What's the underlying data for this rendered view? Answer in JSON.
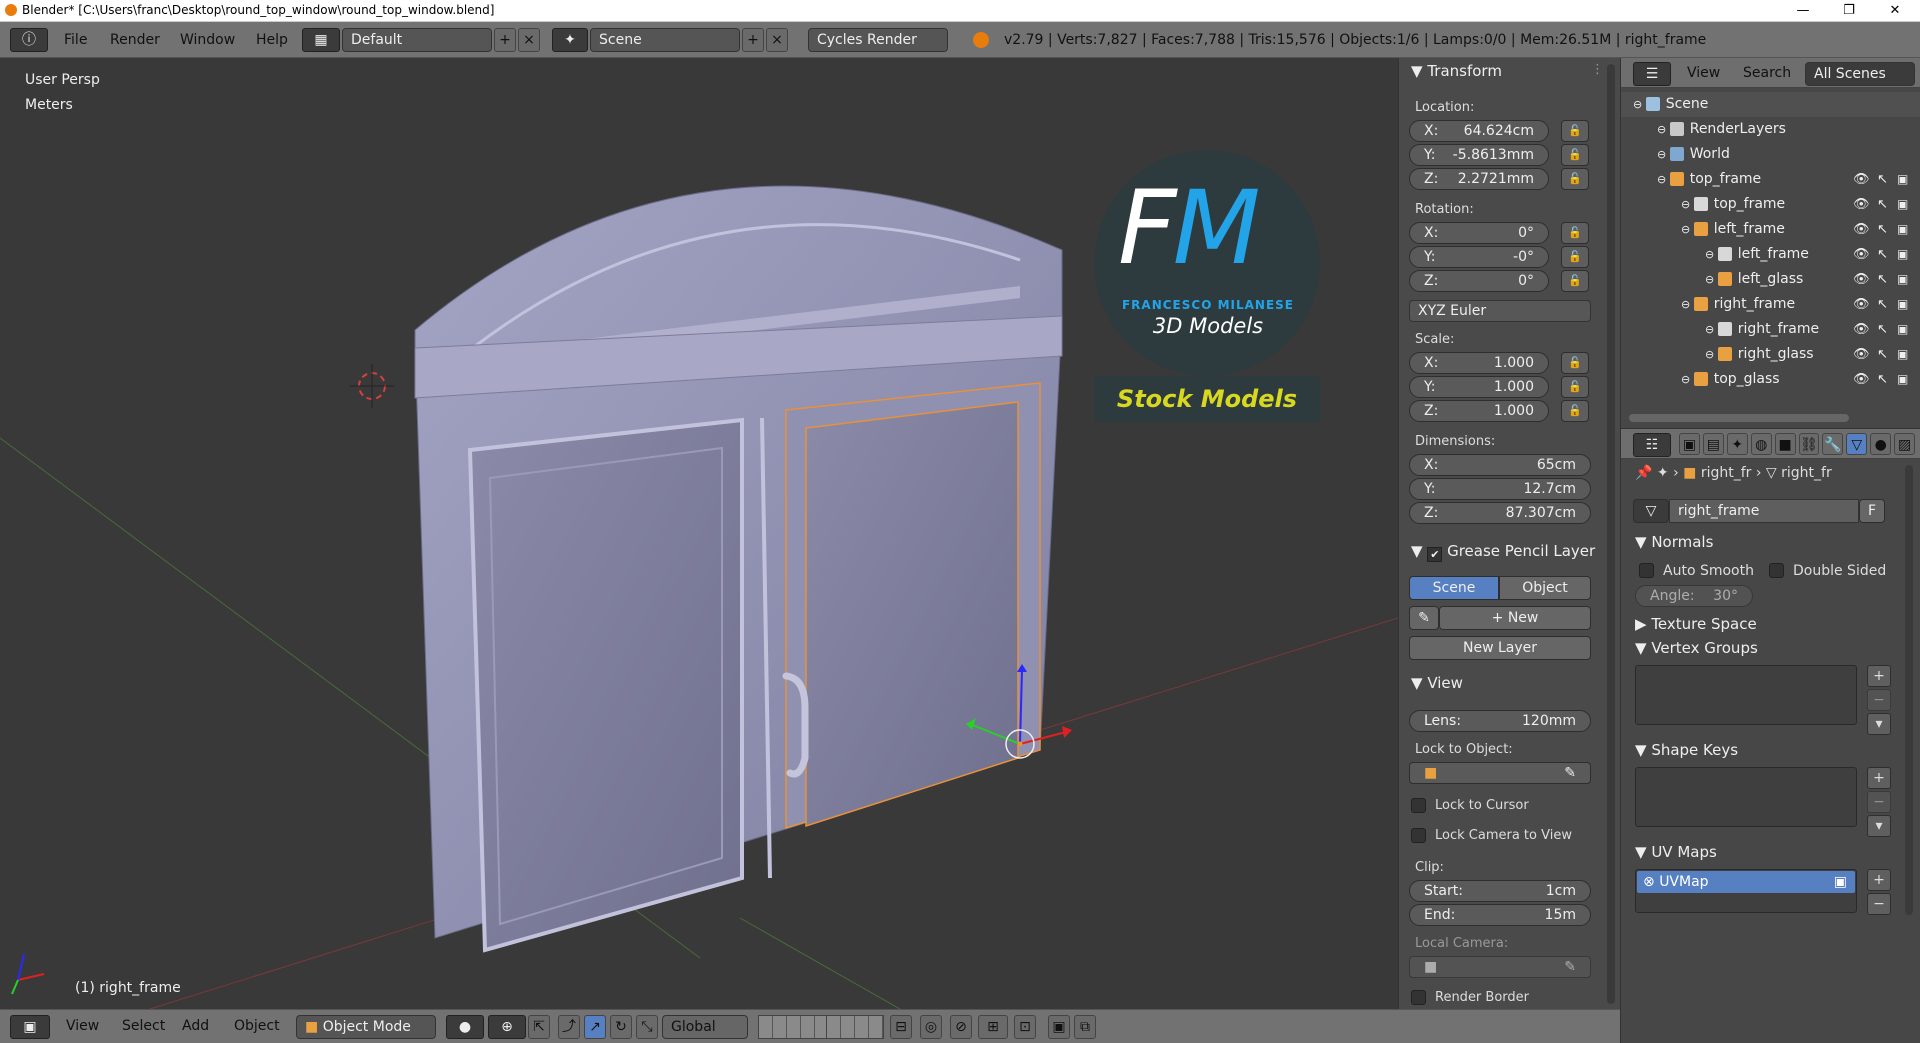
{
  "titlebar": {
    "title": "Blender* [C:\\Users\\franc\\Desktop\\round_top_window\\round_top_window.blend]",
    "minimize": "—",
    "maximize": "❐",
    "close": "✕"
  },
  "topbar": {
    "menus": [
      "File",
      "Render",
      "Window",
      "Help"
    ],
    "layout": "Default",
    "scene": "Scene",
    "engine": "Cycles Render",
    "stats": "v2.79 | Verts:7,827 | Faces:7,788 | Tris:15,576 | Objects:1/6 | Lamps:0/0 | Mem:26.51M | right_frame"
  },
  "viewport": {
    "view_name": "User Persp",
    "units": "Meters",
    "active_object": "(1) right_frame"
  },
  "watermark": {
    "initials": "FM",
    "name": "FRANCESCO MILANESE",
    "tagline": "3D Models",
    "banner": "Stock Models"
  },
  "bottombar": {
    "menus": [
      "View",
      "Select",
      "Add",
      "Object"
    ],
    "mode": "Object Mode",
    "orientation": "Global"
  },
  "transform": {
    "header": "Transform",
    "location_label": "Location:",
    "location": [
      {
        "k": "X:",
        "v": "64.624cm"
      },
      {
        "k": "Y:",
        "v": "-5.8613mm"
      },
      {
        "k": "Z:",
        "v": "2.2721mm"
      }
    ],
    "rotation_label": "Rotation:",
    "rotation": [
      {
        "k": "X:",
        "v": "0°"
      },
      {
        "k": "Y:",
        "v": "-0°"
      },
      {
        "k": "Z:",
        "v": "0°"
      }
    ],
    "rotation_mode": "XYZ Euler",
    "scale_label": "Scale:",
    "scale": [
      {
        "k": "X:",
        "v": "1.000"
      },
      {
        "k": "Y:",
        "v": "1.000"
      },
      {
        "k": "Z:",
        "v": "1.000"
      }
    ],
    "dimensions_label": "Dimensions:",
    "dimensions": [
      {
        "k": "X:",
        "v": "65cm"
      },
      {
        "k": "Y:",
        "v": "12.7cm"
      },
      {
        "k": "Z:",
        "v": "87.307cm"
      }
    ]
  },
  "grease": {
    "header": "Grease Pencil Layer",
    "scene": "Scene",
    "object": "Object",
    "new": "New",
    "new_layer": "New Layer"
  },
  "view": {
    "header": "View",
    "lens_k": "Lens:",
    "lens_v": "120mm",
    "lock_object": "Lock to Object:",
    "lock_cursor": "Lock to Cursor",
    "lock_camera": "Lock Camera to View",
    "clip": "Clip:",
    "start_k": "Start:",
    "start_v": "1cm",
    "end_k": "End:",
    "end_v": "15m",
    "local_camera": "Local Camera:",
    "render_border": "Render Border"
  },
  "outliner": {
    "view": "View",
    "search": "Search",
    "all_scenes": "All Scenes",
    "rows": [
      {
        "label": "Scene",
        "indent": 0,
        "icon": "#9cc0e0"
      },
      {
        "label": "RenderLayers",
        "indent": 1,
        "icon": "#c8c8c8"
      },
      {
        "label": "World",
        "indent": 1,
        "icon": "#7fa8d0"
      },
      {
        "label": "top_frame",
        "indent": 1,
        "icon": "#e8a040"
      },
      {
        "label": "top_frame",
        "indent": 2,
        "icon": "#d8d8d8"
      },
      {
        "label": "left_frame",
        "indent": 2,
        "icon": "#e8a040"
      },
      {
        "label": "left_frame",
        "indent": 3,
        "icon": "#d8d8d8"
      },
      {
        "label": "left_glass",
        "indent": 3,
        "icon": "#e8a040"
      },
      {
        "label": "right_frame",
        "indent": 2,
        "icon": "#e8a040"
      },
      {
        "label": "right_frame",
        "indent": 3,
        "icon": "#d8d8d8"
      },
      {
        "label": "right_glass",
        "indent": 3,
        "icon": "#e8a040"
      },
      {
        "label": "top_glass",
        "indent": 2,
        "icon": "#e8a040"
      }
    ]
  },
  "props": {
    "crumb1": "right_fr",
    "crumb2": "right_fr",
    "mesh_name": "right_frame",
    "fake_user": "F",
    "normals": "Normals",
    "auto_smooth": "Auto Smooth",
    "double_sided": "Double Sided",
    "angle_k": "Angle:",
    "angle_v": "30°",
    "texture_space": "Texture Space",
    "vertex_groups": "Vertex Groups",
    "shape_keys": "Shape Keys",
    "uv_maps": "UV Maps",
    "uv_map_name": "UVMap"
  },
  "colors": {
    "accent": "#5680c2",
    "selection": "#e8913a",
    "mesh": "#8a8aa8"
  }
}
